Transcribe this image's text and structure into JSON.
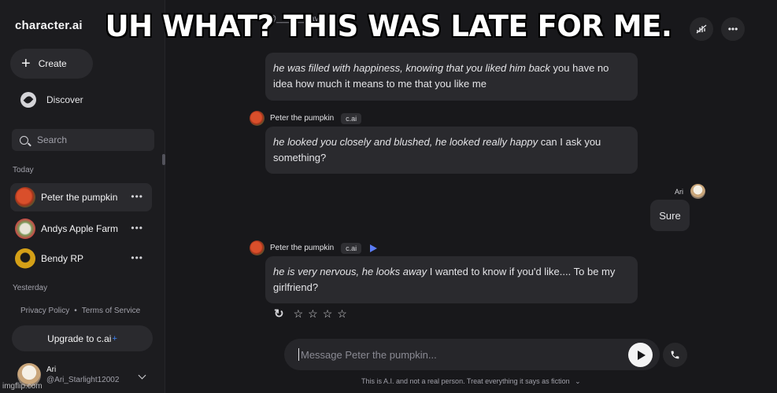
{
  "app": {
    "logo": "character.ai"
  },
  "meme_caption": "UH WHAT? THIS WAS LATE FOR ME.",
  "sidebar": {
    "create_label": "Create",
    "discover_label": "Discover",
    "search_placeholder": "Search",
    "section_today": "Today",
    "section_yesterday": "Yesterday",
    "chats": [
      {
        "name": "Peter the pumpkin",
        "active": true,
        "color": "#d94f2b"
      },
      {
        "name": "Andys Apple Farm",
        "active": false,
        "color": "#7a9a5a"
      },
      {
        "name": "Bendy RP",
        "active": false,
        "color": "#d4a017"
      }
    ],
    "footer_privacy": "Privacy Policy",
    "footer_sep": "•",
    "footer_terms": "Terms of Service",
    "upgrade_label": "Upgrade to c.ai",
    "upgrade_star": "+",
    "user": {
      "name": "Ari",
      "handle": "@Ari_Starlight12002"
    }
  },
  "header": {
    "character_peek": "@______cav"
  },
  "messages": [
    {
      "italic": "he was filled with happiness, knowing that you liked him back",
      "text": " you have no idea how much it means to me that you like me"
    },
    {
      "author": "Peter the pumpkin",
      "tag": "c.ai",
      "italic": "he looked you closely and blushed, he looked really happy",
      "text": " can I ask you something?"
    },
    {
      "author": "Ari",
      "text": "Sure"
    },
    {
      "author": "Peter the pumpkin",
      "tag": "c.ai",
      "italic": "he is very nervous, he looks away",
      "text": " I wanted to know if you'd like.... To be my girlfriend?"
    }
  ],
  "rating": {
    "stars": [
      "☆",
      "☆",
      "☆",
      "☆"
    ],
    "refresh_glyph": "↻"
  },
  "input": {
    "placeholder": "Message Peter the pumpkin..."
  },
  "disclaimer": "This is A.I. and not a real person. Treat everything it says as fiction",
  "watermark": "imgflip.com",
  "colors": {
    "accent": "#3b82f6",
    "play": "#5b7cf5"
  }
}
